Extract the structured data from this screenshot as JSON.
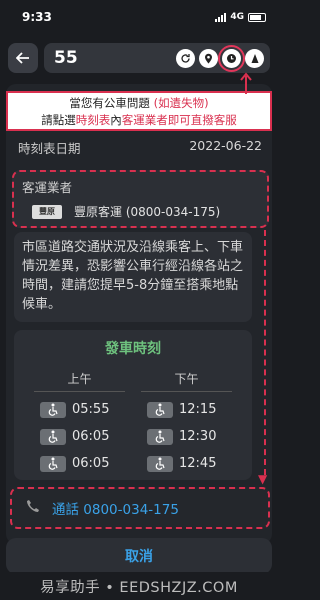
{
  "status_bar": {
    "time": "9:33",
    "network": "4G"
  },
  "header": {
    "route_number": "55"
  },
  "callout": {
    "line1_prefix": "當您有公車問題 ",
    "line1_highlight": "(如遺失物)",
    "line2_prefix": "請點選",
    "line2_highlight1": "時刻表",
    "line2_mid": "內",
    "line2_highlight2": "客運業者即可直撥客服"
  },
  "schedule_info": {
    "date_label": "時刻表日期",
    "date_value": "2022-06-22",
    "operator_label": "客運業者",
    "operator_logo": "豐原",
    "operator_name": "豐原客運 (0800-034-175)"
  },
  "notice": {
    "text": "市區道路交通狀況及沿線乘客上、下車情況差異，恐影響公車行經沿線各站之時間，建請您提早5-8分鐘至搭乘地點候車。"
  },
  "departures": {
    "title": "發車時刻",
    "am_label": "上午",
    "pm_label": "下午",
    "rows": [
      {
        "am": "05:55",
        "pm": "12:15"
      },
      {
        "am": "06:05",
        "pm": "12:30"
      },
      {
        "am": "06:05",
        "pm": "12:45"
      }
    ]
  },
  "actions": {
    "call_label": "通話 0800-034-175",
    "cancel_label": "取消"
  },
  "watermark": {
    "text": "易享助手 • EEDSHZJZ.COM"
  },
  "colors": {
    "accent_red": "#d9304f",
    "accent_blue": "#3aa2e8",
    "accent_green": "#6ec27e"
  }
}
